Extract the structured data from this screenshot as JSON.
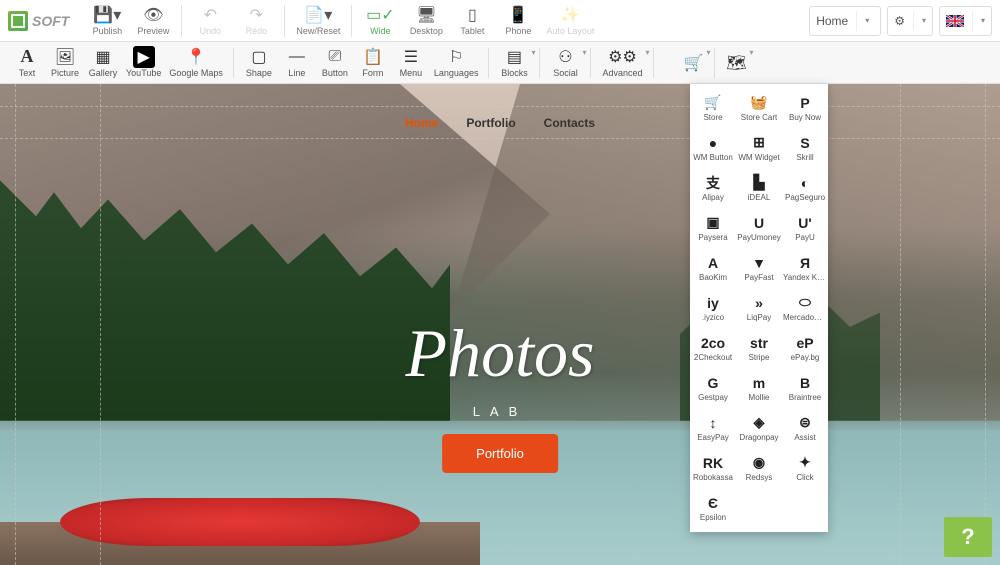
{
  "logo_text": "SOFT",
  "topbar": {
    "publish": "Publish",
    "preview": "Preview",
    "undo": "Undo",
    "redo": "Redo",
    "newreset": "New/Reset",
    "wide": "Wide",
    "desktop": "Desktop",
    "tablet": "Tablet",
    "phone": "Phone",
    "autolayout": "Auto Layout"
  },
  "top_right": {
    "page_selector": "Home"
  },
  "iconbar": {
    "text": "Text",
    "picture": "Picture",
    "gallery": "Gallery",
    "youtube": "YouTube",
    "googlemaps": "Google Maps",
    "shape": "Shape",
    "line": "Line",
    "button": "Button",
    "form": "Form",
    "menu": "Menu",
    "languages": "Languages",
    "blocks": "Blocks",
    "social": "Social",
    "advanced": "Advanced"
  },
  "site": {
    "nav": {
      "home": "Home",
      "portfolio": "Portfolio",
      "contacts": "Contacts"
    },
    "hero_title": "Photos",
    "hero_sub": "LAB",
    "hero_button": "Portfolio"
  },
  "cart_dropdown": [
    {
      "icon": "🛒",
      "label": "Store"
    },
    {
      "icon": "🧺",
      "label": "Store Cart"
    },
    {
      "icon": "P",
      "label": "Buy Now"
    },
    {
      "icon": "●",
      "label": "WM Button"
    },
    {
      "icon": "⊞",
      "label": "WM Widget"
    },
    {
      "icon": "S",
      "label": "Skrill"
    },
    {
      "icon": "支",
      "label": "Alipay"
    },
    {
      "icon": "▙",
      "label": "iDEAL"
    },
    {
      "icon": "◐",
      "label": "PagSeguro"
    },
    {
      "icon": "▣",
      "label": "Paysera"
    },
    {
      "icon": "U",
      "label": "PayUmoney"
    },
    {
      "icon": "U'",
      "label": "PayU"
    },
    {
      "icon": "A",
      "label": "BaoKim"
    },
    {
      "icon": "▼",
      "label": "PayFast"
    },
    {
      "icon": "Я",
      "label": "Yandex Kassa"
    },
    {
      "icon": "iy",
      "label": ".iyzico"
    },
    {
      "icon": "»",
      "label": "LiqPay"
    },
    {
      "icon": "⬭",
      "label": "MercadoPago"
    },
    {
      "icon": "2co",
      "label": "2Checkout"
    },
    {
      "icon": "str",
      "label": "Stripe"
    },
    {
      "icon": "eP",
      "label": "ePay.bg"
    },
    {
      "icon": "G",
      "label": "Gestpay"
    },
    {
      "icon": "m",
      "label": "Mollie"
    },
    {
      "icon": "B",
      "label": "Braintree"
    },
    {
      "icon": "↕",
      "label": "EasyPay"
    },
    {
      "icon": "◈",
      "label": "Dragonpay"
    },
    {
      "icon": "⊜",
      "label": "Assist"
    },
    {
      "icon": "RK",
      "label": "Robokassa"
    },
    {
      "icon": "◉",
      "label": "Redsys"
    },
    {
      "icon": "✦",
      "label": "Click"
    },
    {
      "icon": "Є",
      "label": "Epsilon"
    }
  ],
  "help": "?"
}
